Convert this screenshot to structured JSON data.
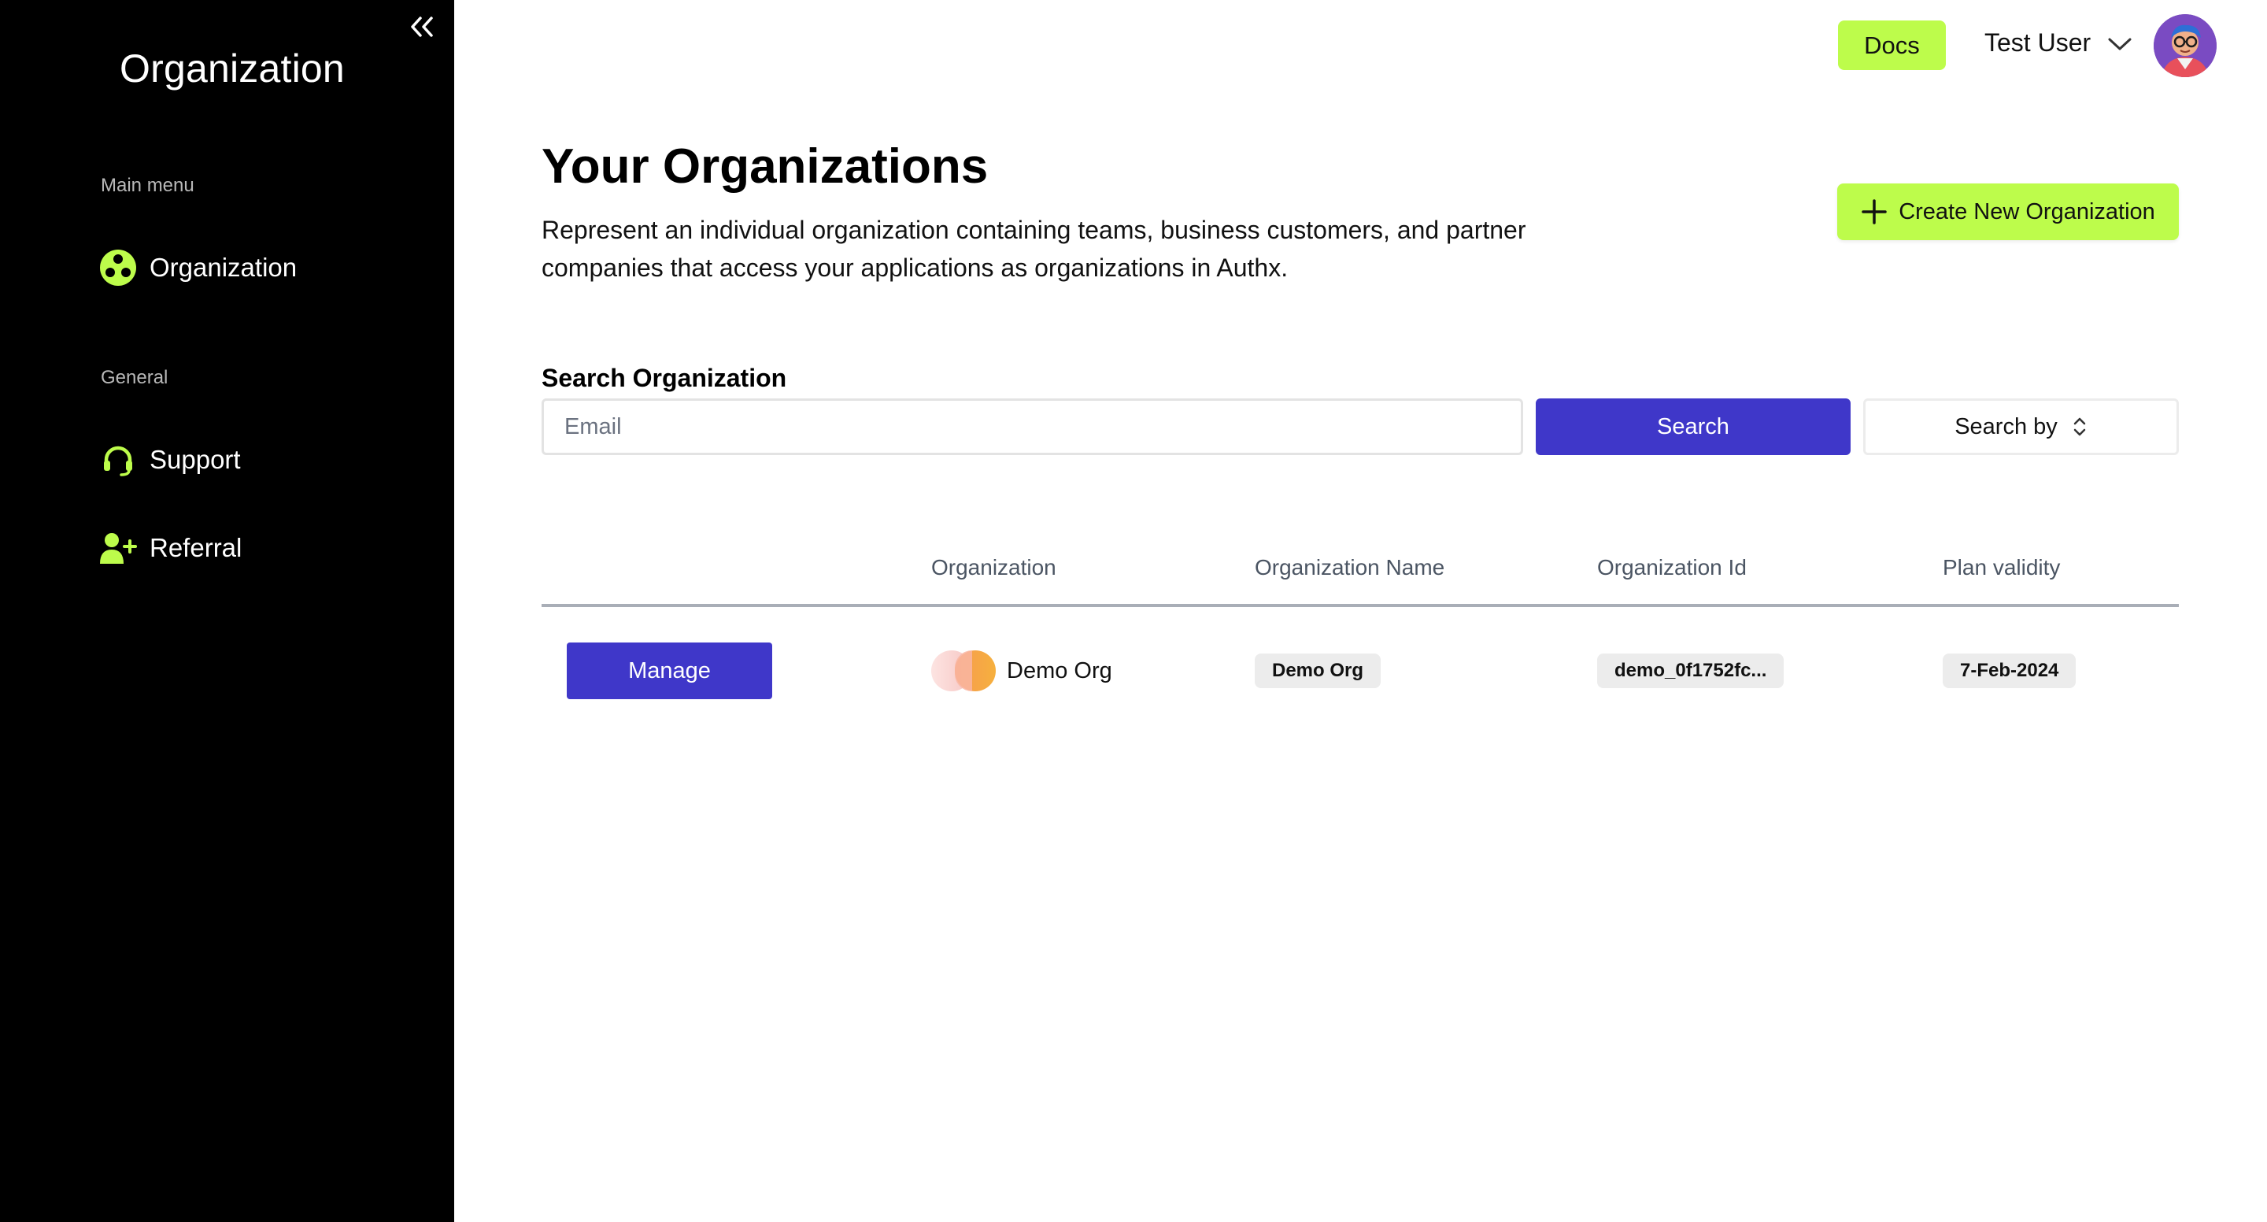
{
  "sidebar": {
    "title": "Organization",
    "sections": [
      {
        "label": "Main menu",
        "items": [
          {
            "label": "Organization",
            "icon": "organization-icon"
          }
        ]
      },
      {
        "label": "General",
        "items": [
          {
            "label": "Support",
            "icon": "headset-icon"
          },
          {
            "label": "Referral",
            "icon": "user-plus-icon"
          }
        ]
      }
    ],
    "accent_color": "#bdfc4b"
  },
  "header": {
    "docs_label": "Docs",
    "user_name": "Test User"
  },
  "main": {
    "title": "Your Organizations",
    "description": "Represent an individual organization containing teams, business customers, and partner companies that access your applications as organizations in Authx.",
    "create_label": "Create New Organization",
    "search": {
      "label": "Search Organization",
      "placeholder": "Email",
      "value": "",
      "button_label": "Search",
      "search_by_label": "Search by"
    },
    "table": {
      "columns": [
        "",
        "Organization",
        "Organization Name",
        "Organization Id",
        "Plan validity"
      ],
      "rows": [
        {
          "action_label": "Manage",
          "organization": "Demo Org",
          "organization_name": "Demo Org",
          "organization_id": "demo_0f1752fc...",
          "plan_validity": "7-Feb-2024"
        }
      ]
    }
  },
  "colors": {
    "primary": "#3f37c9",
    "accent": "#bdfc4b",
    "sidebar_bg": "#000000"
  }
}
